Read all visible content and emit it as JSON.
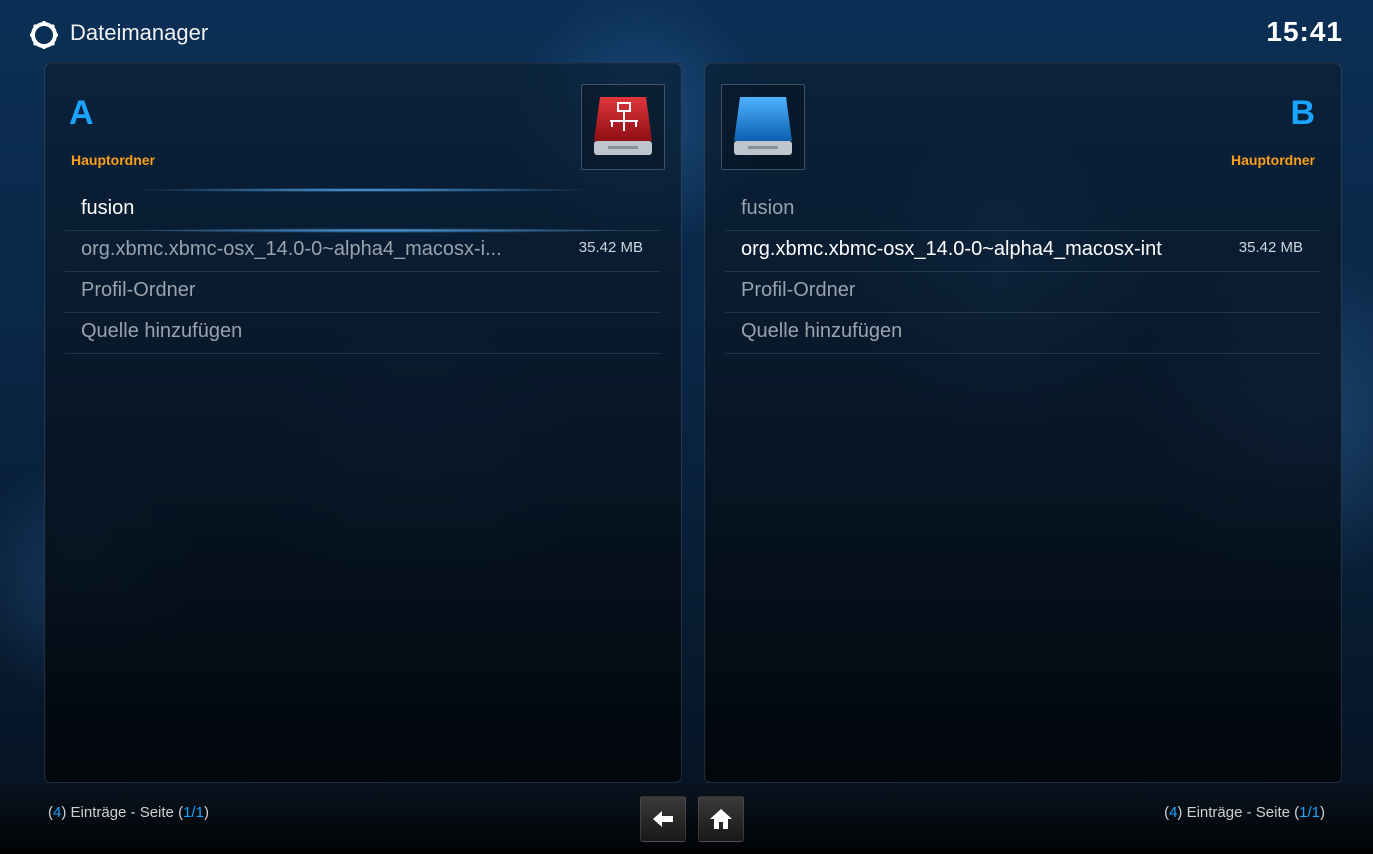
{
  "app": {
    "title": "Dateimanager",
    "time": "15:41"
  },
  "panels": {
    "left": {
      "letter": "A",
      "folder": "Hauptordner",
      "items": [
        {
          "label": "fusion",
          "size": ""
        },
        {
          "label": "org.xbmc.xbmc-osx_14.0-0~alpha4_macosx-i...",
          "size": "35.42 MB"
        },
        {
          "label": "Profil-Ordner",
          "size": ""
        },
        {
          "label": "Quelle hinzufügen",
          "size": ""
        }
      ],
      "status": {
        "count": "4",
        "pre": "Einträge - Seite (",
        "page": "1/1",
        "post": ")"
      }
    },
    "right": {
      "letter": "B",
      "folder": "Hauptordner",
      "items": [
        {
          "label": "fusion",
          "size": ""
        },
        {
          "label": "org.xbmc.xbmc-osx_14.0-0~alpha4_macosx-int",
          "size": "35.42 MB"
        },
        {
          "label": "Profil-Ordner",
          "size": ""
        },
        {
          "label": "Quelle hinzufügen",
          "size": ""
        }
      ],
      "status": {
        "count": "4",
        "pre": "Einträge - Seite (",
        "page": "1/1",
        "post": ")"
      }
    }
  },
  "icons": {
    "app": "gear-icon",
    "left_drive": "network-drive-icon",
    "right_drive": "drive-icon",
    "back": "back-arrow-icon",
    "home": "home-icon"
  },
  "colors": {
    "accent": "#1aa3ff",
    "folder": "#ff9f1a",
    "background": "#0a2746",
    "left_drive": "#c4161c",
    "right_drive": "#1a7fd8"
  }
}
